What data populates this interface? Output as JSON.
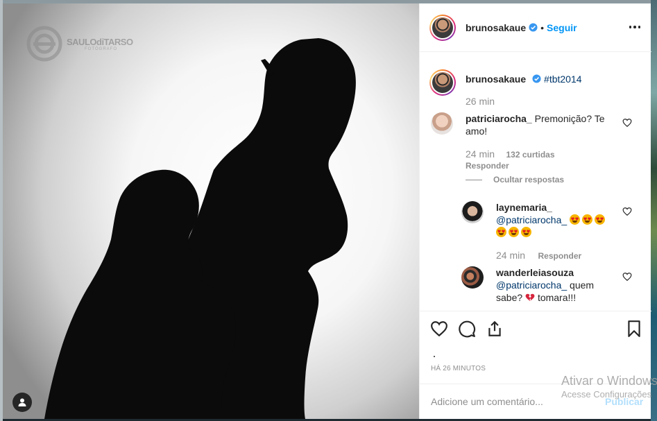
{
  "post": {
    "author": "brunosakaue",
    "follow_label": "Seguir",
    "separator": "•",
    "caption_hashtag": "#tbt2014",
    "caption_time": "26 min",
    "timestamp": "HÁ 26 MINUTOS",
    "photo_watermark": {
      "name": "SAULOdiTARSO",
      "subtitle": "FOTÓGRAFO"
    }
  },
  "comments": [
    {
      "user": "patriciarocha_",
      "text": "Premonição? Te amo!",
      "time": "24 min",
      "likes": "132 curtidas",
      "reply_label": "Responder",
      "hide_replies_label": "Ocultar respostas",
      "replies": [
        {
          "user": "laynemaria_",
          "mention": "@patriciarocha_",
          "emoji_count": 6,
          "emoji_name": "star-struck-heart-eyes",
          "time": "24 min",
          "reply_label": "Responder"
        },
        {
          "user": "wanderleiasouza",
          "mention": "@patriciarocha_",
          "text_before_emoji": "quem sabe?",
          "emoji_name": "broken-heart",
          "text_after_emoji": "tomara!!!"
        }
      ]
    }
  ],
  "add_comment": {
    "placeholder": "Adicione um comentário...",
    "publish_label": "Publicar"
  },
  "os_overlay": {
    "line1": "Ativar o Windows",
    "line2": "Acesse Configurações"
  },
  "colors": {
    "link": "#00376b",
    "follow": "#0095f6",
    "muted": "#8e8e8e",
    "verified": "#3897f0"
  }
}
